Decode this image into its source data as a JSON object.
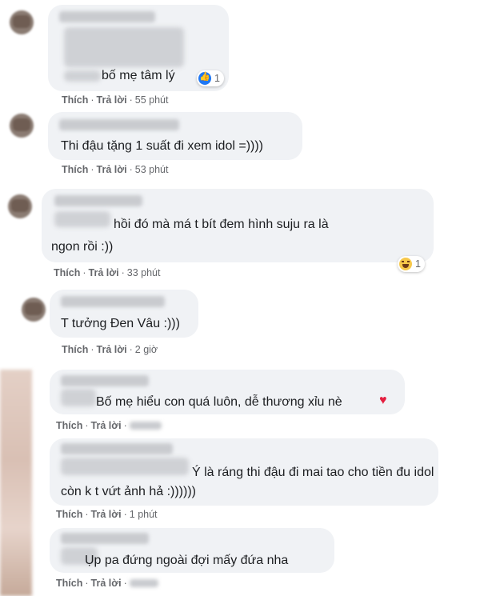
{
  "comments": [
    {
      "text": "bố mẹ tâm lý",
      "like": "Thích",
      "reply": "Trả lời",
      "time": "55 phút",
      "reaction": {
        "icon": "like-icon",
        "count": "1"
      }
    },
    {
      "text": "Thi đậu tặng 1 suất đi xem idol =))))",
      "like": "Thích",
      "reply": "Trả lời",
      "time": "53 phút"
    },
    {
      "line1": "hồi đó mà má t bít đem hình suju ra là",
      "line2": "ngon rồi :))",
      "like": "Thích",
      "reply": "Trả lời",
      "time": "33 phút",
      "reaction": {
        "icon": "haha-icon",
        "count": "1"
      }
    },
    {
      "text": "T tưởng Đen Vâu :)))",
      "like": "Thích",
      "reply": "Trả lời",
      "time": "2 giờ"
    },
    {
      "text": "Bố mẹ hiểu con quá luôn, dễ thương xỉu nè",
      "emoji": "heart-icon",
      "like": "Thích",
      "reply": "Trả lời"
    },
    {
      "line1": "Ý là ráng thi đậu đi mai tao cho tiền đu idol",
      "line2": "còn k t vứt ảnh hả :))))))",
      "like": "Thích",
      "reply": "Trả lời",
      "time": "1 phút"
    },
    {
      "text": "Ụp pa đứng ngoài đợi mấy đứa nha",
      "like": "Thích",
      "reply": "Trả lời"
    }
  ]
}
